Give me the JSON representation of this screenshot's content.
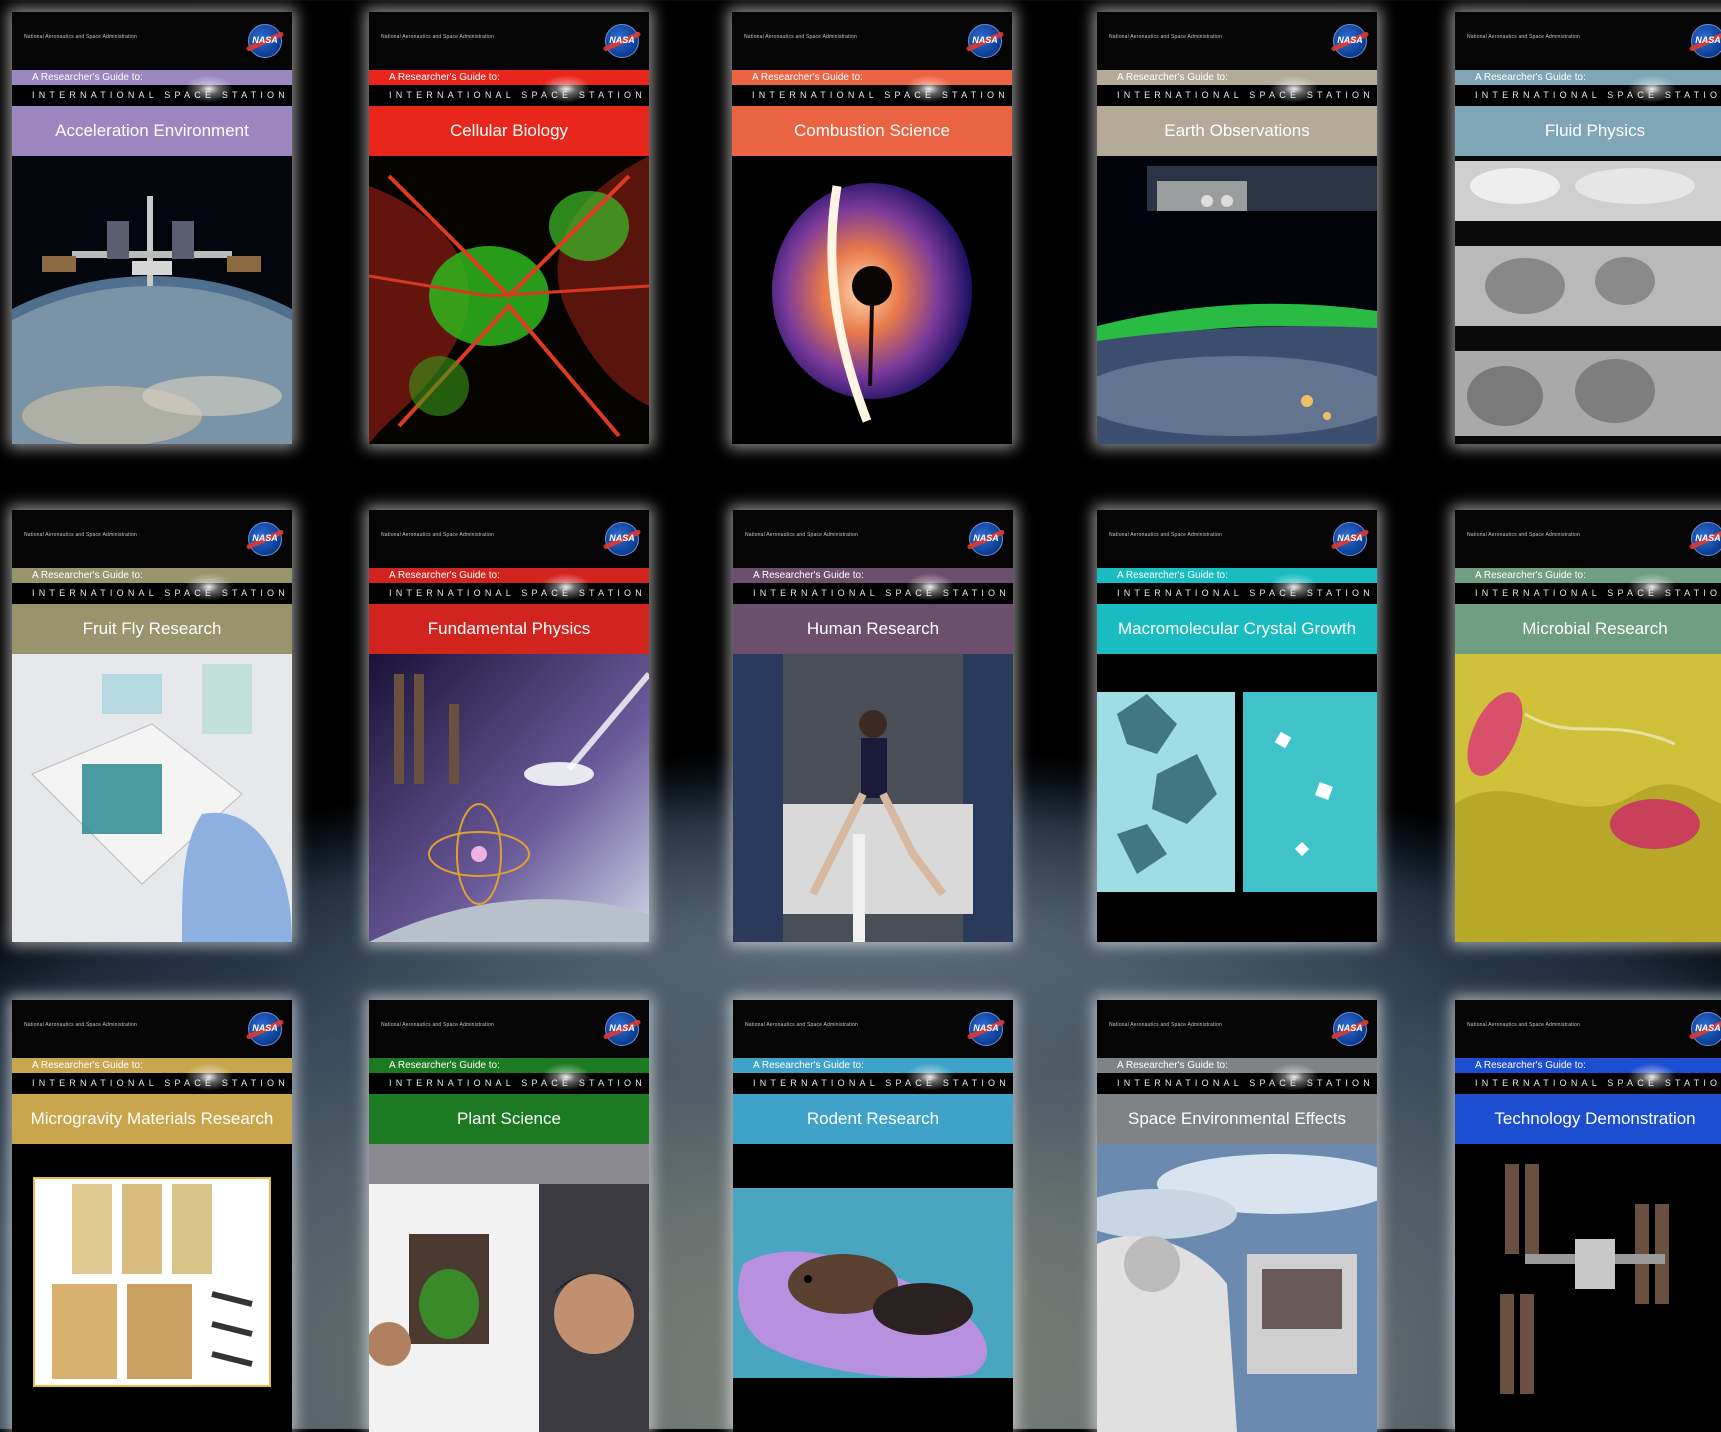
{
  "common": {
    "agency": "National Aeronautics and Space Administration",
    "logo_text": "NASA",
    "guide_label": "A Researcher's Guide to:",
    "station_label": "INTERNATIONAL SPACE STATION"
  },
  "booklets": [
    {
      "title": "Acceleration Environment",
      "color": "#9b86c0"
    },
    {
      "title": "Cellular Biology",
      "color": "#e8261c"
    },
    {
      "title": "Combustion Science",
      "color": "#ea6443"
    },
    {
      "title": "Earth Observations",
      "color": "#b3ab98"
    },
    {
      "title": "Fluid Physics",
      "color": "#7fa6b6"
    },
    {
      "title": "Fruit Fly Research",
      "color": "#98956c"
    },
    {
      "title": "Fundamental Physics",
      "color": "#d1241f"
    },
    {
      "title": "Human Research",
      "color": "#6c4e6d"
    },
    {
      "title": "Macromolecular Crystal Growth",
      "color": "#19bcc0"
    },
    {
      "title": "Microbial Research",
      "color": "#6f9e82"
    },
    {
      "title": "Microgravity Materials Research",
      "color": "#c9a64e"
    },
    {
      "title": "Plant Science",
      "color": "#1b7a22"
    },
    {
      "title": "Rodent Research",
      "color": "#3fa3c9"
    },
    {
      "title": "Space Environmental Effects",
      "color": "#7f8385"
    },
    {
      "title": "Technology Demonstration",
      "color": "#1d4ed2"
    }
  ]
}
